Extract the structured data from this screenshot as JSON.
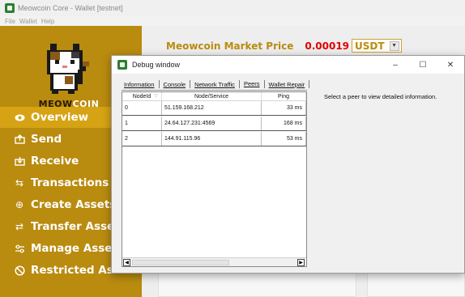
{
  "app": {
    "title": "Meowcoin Core - Wallet [testnet]",
    "menu": [
      "File",
      "Wallet",
      "Help"
    ]
  },
  "sidebar": {
    "logo_text_a": "MEOW",
    "logo_text_b": "COIN",
    "items": [
      {
        "label": "Overview",
        "icon": "eye-icon",
        "active": true
      },
      {
        "label": "Send",
        "icon": "send-icon",
        "active": false
      },
      {
        "label": "Receive",
        "icon": "receive-icon",
        "active": false
      },
      {
        "label": "Transactions",
        "icon": "transactions-icon",
        "active": false
      },
      {
        "label": "Create Assets",
        "icon": "plus-circle-icon",
        "active": false
      },
      {
        "label": "Transfer Assets",
        "icon": "transfer-icon",
        "active": false
      },
      {
        "label": "Manage Assets",
        "icon": "manage-icon",
        "active": false
      },
      {
        "label": "Restricted Assets",
        "icon": "restricted-icon",
        "active": false
      }
    ]
  },
  "market": {
    "label": "Meowcoin Market Price",
    "price": "0.00019",
    "currency": "USDT"
  },
  "debug_window": {
    "title": "Debug window",
    "controls": {
      "minimize": "–",
      "maximize": "☐",
      "close": "✕"
    },
    "tabs": [
      "Information",
      "Console",
      "Network Traffic",
      "Peers",
      "Wallet Repair"
    ],
    "selected_tab": "Peers",
    "peers": {
      "columns": [
        "NodeId",
        "Node/Service",
        "Ping"
      ],
      "rows": [
        {
          "id": "0",
          "service": "51.159.168.212",
          "ping": "33 ms"
        },
        {
          "id": "1",
          "service": "24.64.127.231:4569",
          "ping": "168 ms"
        },
        {
          "id": "2",
          "service": "144.91.115.96",
          "ping": "53 ms"
        }
      ]
    },
    "peer_info_placeholder": "Select a peer to view detailed information."
  },
  "colors": {
    "sidebar": "#b98b0f",
    "sidebar_active": "#d6a314",
    "accent": "#b98b0f",
    "price": "#e00000"
  }
}
